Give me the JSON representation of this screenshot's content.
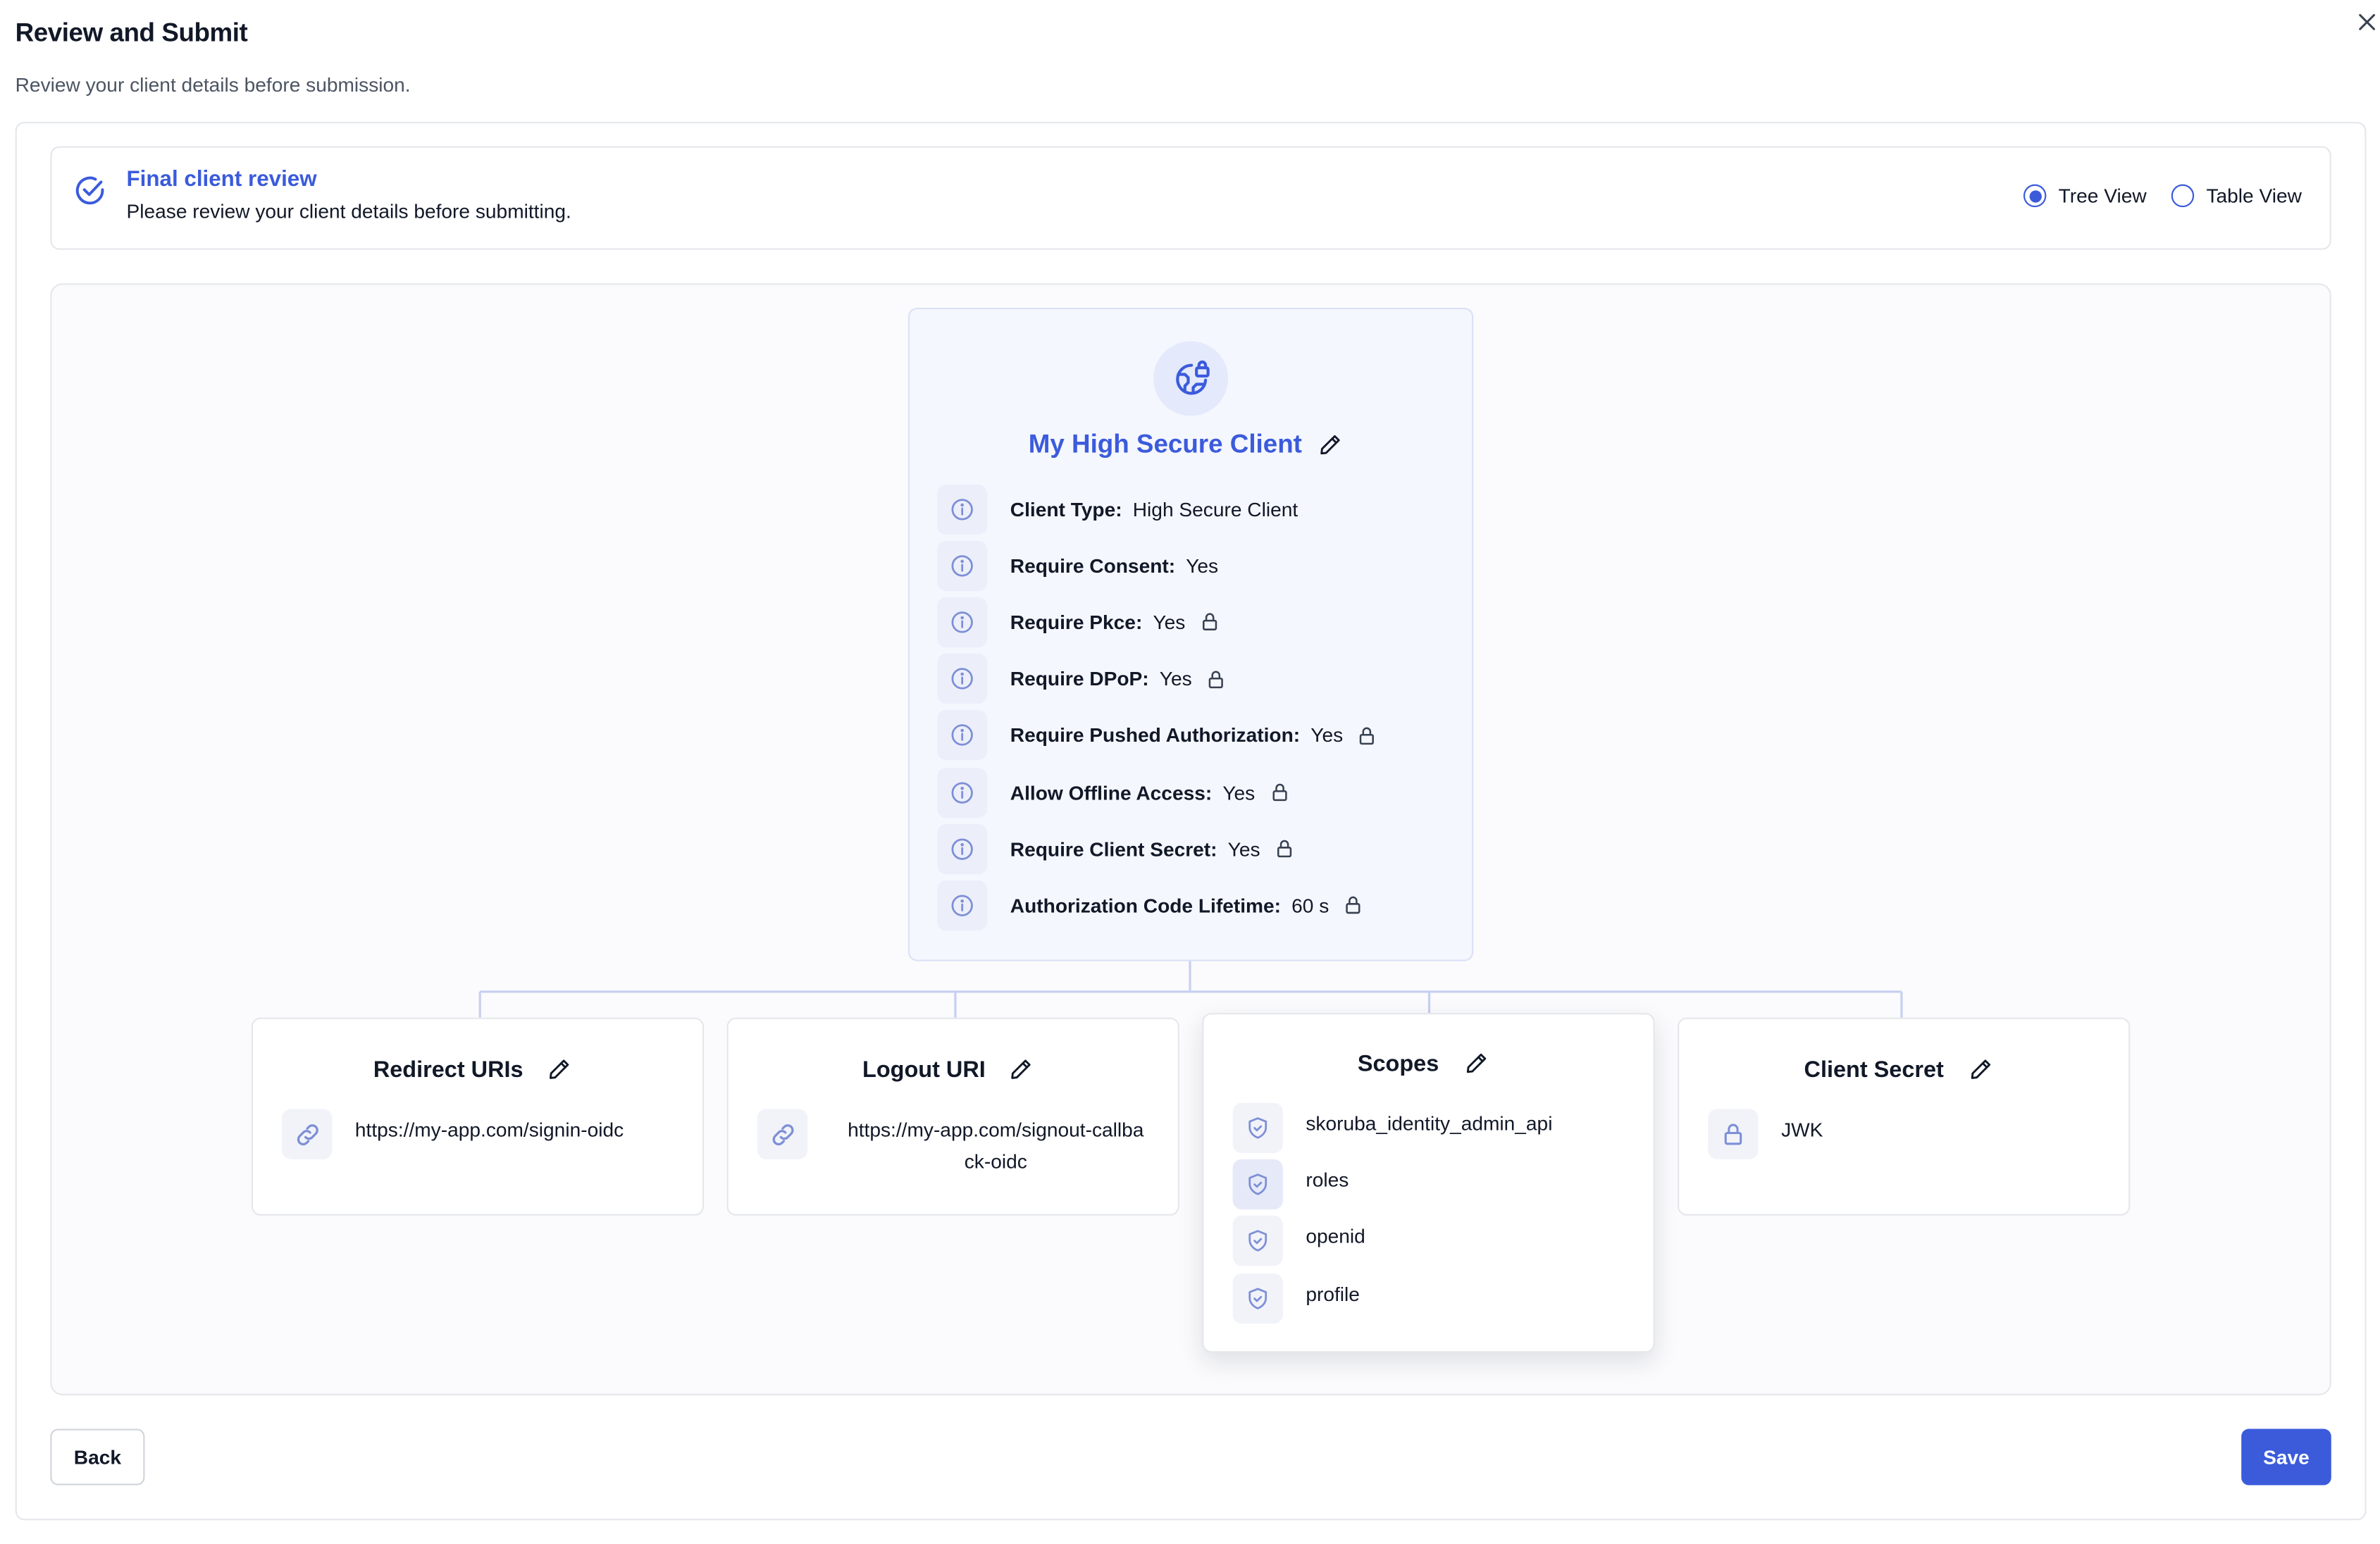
{
  "dialog": {
    "title": "Review and Submit",
    "subtitle": "Review your client details before submission."
  },
  "banner": {
    "title": "Final client review",
    "text": "Please review your client details before submitting."
  },
  "view_toggle": {
    "options": [
      {
        "label": "Tree View",
        "selected": true
      },
      {
        "label": "Table View",
        "selected": false
      }
    ]
  },
  "client": {
    "name": "My High Secure Client",
    "properties": [
      {
        "label": "Client Type:",
        "value": "High Secure Client",
        "locked": false
      },
      {
        "label": "Require Consent:",
        "value": "Yes",
        "locked": false
      },
      {
        "label": "Require Pkce:",
        "value": "Yes",
        "locked": true
      },
      {
        "label": "Require DPoP:",
        "value": "Yes",
        "locked": true
      },
      {
        "label": "Require Pushed Authorization:",
        "value": "Yes",
        "locked": true
      },
      {
        "label": "Allow Offline Access:",
        "value": "Yes",
        "locked": true
      },
      {
        "label": "Require Client Secret:",
        "value": "Yes",
        "locked": true
      },
      {
        "label": "Authorization Code Lifetime:",
        "value": "60 s",
        "locked": true
      }
    ]
  },
  "redirect_uris": {
    "title": "Redirect URIs",
    "items": [
      "https://my-app.com/signin-oidc"
    ]
  },
  "logout_uri": {
    "title": "Logout URI",
    "line1": "https://my-app.com/signout-callba",
    "line2": "ck-oidc"
  },
  "scopes": {
    "title": "Scopes",
    "items": [
      "skoruba_identity_admin_api",
      "roles",
      "openid",
      "profile"
    ]
  },
  "client_secret": {
    "title": "Client Secret",
    "items": [
      "JWK"
    ]
  },
  "footer": {
    "back_label": "Back",
    "save_label": "Save"
  },
  "colors": {
    "accent": "#3b5bdb",
    "border": "#e5e7eb",
    "icon_bg": "#eceffa"
  }
}
